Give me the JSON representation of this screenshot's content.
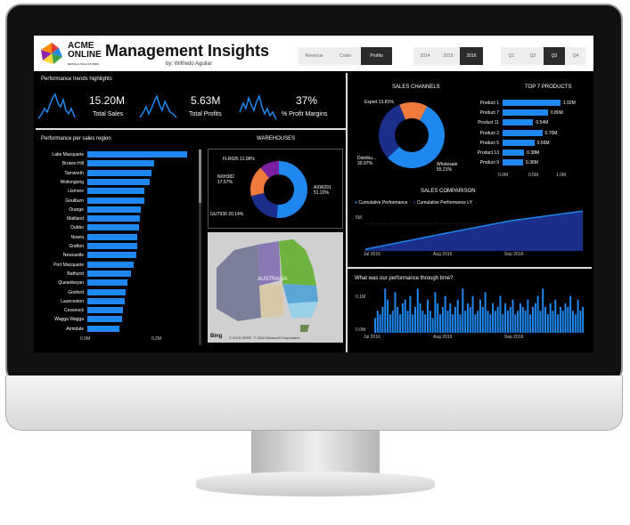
{
  "app": {
    "logo_line1": "ACME",
    "logo_line2": "ONLINE",
    "logo_sub": "RETAIL & TECH STORES",
    "title": "Management Insights",
    "byline": "by: Wilfredo Aguilar"
  },
  "metric_tabs": [
    {
      "label": "Revenue",
      "active": false
    },
    {
      "label": "Costs",
      "active": false
    },
    {
      "label": "Profits",
      "active": true
    }
  ],
  "year_tabs": [
    {
      "label": "2014",
      "active": false
    },
    {
      "label": "2015",
      "active": false
    },
    {
      "label": "2016",
      "active": true
    }
  ],
  "quarter_tabs": [
    {
      "label": "Q1",
      "active": false
    },
    {
      "label": "Q2",
      "active": false
    },
    {
      "label": "Q3",
      "active": true
    },
    {
      "label": "Q4",
      "active": false
    }
  ],
  "highlights": {
    "title": "Performance trends highlights",
    "kpis": [
      {
        "value": "15.20M",
        "label": "Total Sales"
      },
      {
        "value": "5.63M",
        "label": "Total Profits"
      },
      {
        "value": "37%",
        "label": "% Profit Margins"
      }
    ]
  },
  "regions": {
    "title": "Performance per sales region",
    "axis": [
      "0.0M",
      "0.2M"
    ],
    "chart_data": {
      "type": "bar",
      "orientation": "horizontal",
      "categories": [
        "Lake Macquarie",
        "Broken Hill",
        "Tamworth",
        "Wollongong",
        "Lismore",
        "Goulburn",
        "Orange",
        "Maitland",
        "Dubbo",
        "Nowra",
        "Grafton",
        "Newcastle",
        "Port Macquarie",
        "Bathurst",
        "Queanbeyan",
        "Gosford",
        "Launceston",
        "Cessnock",
        "Wagga Wagga",
        "Armidale"
      ],
      "values": [
        0.276,
        0.185,
        0.176,
        0.173,
        0.158,
        0.157,
        0.148,
        0.144,
        0.142,
        0.137,
        0.137,
        0.134,
        0.127,
        0.121,
        0.111,
        0.105,
        0.103,
        0.098,
        0.095,
        0.088
      ],
      "xlim": [
        0,
        0.28
      ]
    }
  },
  "warehouses": {
    "title": "WAREHOUSES",
    "chart_data": {
      "type": "pie",
      "labels": [
        "AXW291",
        "GUT930",
        "NXH382",
        "FLR025"
      ],
      "values": [
        51.22,
        20.14,
        17.57,
        11.08
      ],
      "colors": [
        "#1e88f0",
        "#1a2e8a",
        "#f07a3c",
        "#7b1fa2"
      ]
    },
    "label_texts": [
      "FLR025 11.08%",
      "NXH382 17.57%",
      "GUT930 20.14%",
      "AXW291 51.22%"
    ]
  },
  "map": {
    "region_label": "AUSTRALIA",
    "attribution": "Bing",
    "copyright": "© 2020 HERE, © 2020 Microsoft Corporation"
  },
  "channels": {
    "title": "SALES CHANNELS",
    "chart_data": {
      "type": "pie",
      "labels": [
        "Wholesale",
        "Distributor",
        "Export"
      ],
      "values": [
        55.21,
        30.97,
        13.81
      ],
      "colors": [
        "#1e88f0",
        "#1a2e8a",
        "#f07a3c"
      ]
    },
    "label_texts": [
      "Export 13.81%",
      "Distribu... 30.97%",
      "Wholesale 55.21%"
    ]
  },
  "products": {
    "title": "TOP 7 PRODUCTS",
    "axis": [
      "0.0M",
      "0.5M",
      "1.0M"
    ],
    "chart_data": {
      "type": "bar",
      "orientation": "horizontal",
      "categories": [
        "Product 1",
        "Product 7",
        "Product 11",
        "Product 2",
        "Product 5",
        "Product 13",
        "Product 9"
      ],
      "values": [
        1.02,
        0.8,
        0.54,
        0.7,
        0.56,
        0.38,
        0.36
      ],
      "labels": [
        "1.02M",
        "0.80M",
        "0.54M",
        "0.70M",
        "0.56M",
        "0.38M",
        "0.36M"
      ],
      "xlim": [
        0,
        1.1
      ]
    }
  },
  "comparison": {
    "title": "SALES COMPARISON",
    "legend": [
      "Cumulative Performance",
      "Cumulative Performance LY"
    ],
    "y_tick": "5M",
    "x_ticks": [
      "Jul 2016",
      "Aug 2016",
      "Sep 2016"
    ],
    "chart_data": {
      "type": "area",
      "series": [
        {
          "name": "Cumulative Performance",
          "x": [
            "Jul 2016",
            "Aug 2016",
            "Sep 2016",
            "end"
          ],
          "values": [
            0.3,
            3.0,
            5.6,
            7.4
          ]
        }
      ]
    }
  },
  "through_time": {
    "title": "What was our performance through time?",
    "y_ticks": [
      "0.1M",
      "0.0M"
    ],
    "x_ticks": [
      "Jul 2016",
      "Aug 2016",
      "Sep 2016"
    ],
    "chart_data": {
      "type": "bar",
      "values": [
        0.04,
        0.06,
        0.05,
        0.07,
        0.12,
        0.09,
        0.05,
        0.06,
        0.11,
        0.07,
        0.05,
        0.08,
        0.09,
        0.06,
        0.1,
        0.05,
        0.07,
        0.12,
        0.08,
        0.06,
        0.05,
        0.09,
        0.06,
        0.04,
        0.11,
        0.08,
        0.05,
        0.07,
        0.1,
        0.06,
        0.08,
        0.05,
        0.07,
        0.09,
        0.05,
        0.12,
        0.06,
        0.08,
        0.07,
        0.1,
        0.05,
        0.06,
        0.09,
        0.07,
        0.11,
        0.06,
        0.05,
        0.08,
        0.06,
        0.07,
        0.1,
        0.05,
        0.08,
        0.06,
        0.07,
        0.09,
        0.05,
        0.06,
        0.08,
        0.07,
        0.06,
        0.09,
        0.05,
        0.07,
        0.08,
        0.1,
        0.06,
        0.12,
        0.07,
        0.05,
        0.08,
        0.06,
        0.09,
        0.05,
        0.07,
        0.06,
        0.08,
        0.07,
        0.1,
        0.06,
        0.05,
        0.09,
        0.06,
        0.07
      ],
      "ylim": [
        0,
        0.14
      ]
    }
  }
}
